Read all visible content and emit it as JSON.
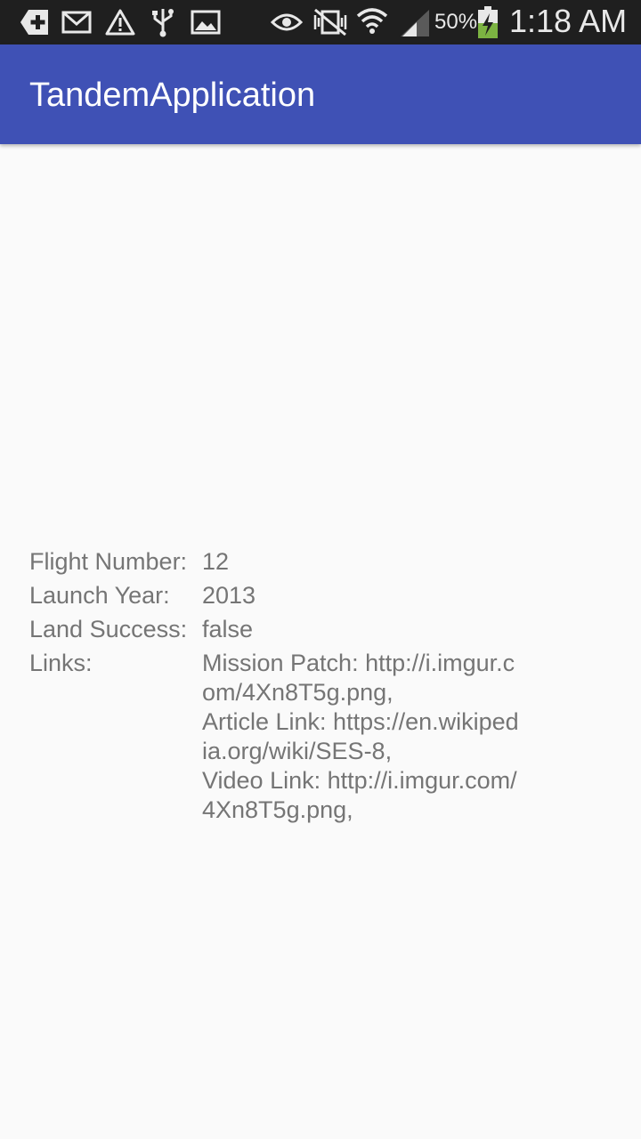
{
  "status_bar": {
    "battery_percent": "50%",
    "time": "1:18 AM",
    "icons": [
      "add-icon",
      "mail-icon",
      "warning-icon",
      "usb-icon",
      "image-icon",
      "eye-icon",
      "mute-vibrate-icon",
      "wifi-icon",
      "cell-signal-icon",
      "battery-charging-icon"
    ]
  },
  "app_bar": {
    "title": "TandemApplication",
    "color": "#3f51b5"
  },
  "details": {
    "flight_number": {
      "label": "Flight Number:",
      "value": "12"
    },
    "launch_year": {
      "label": "Launch Year:",
      "value": "2013"
    },
    "land_success": {
      "label": "Land Success:",
      "value": "false"
    },
    "links": {
      "label": "Links:",
      "mission_patch": "Mission Patch: http://​i.imgur.com/4Xn8T5g.png,",
      "article_link": "Article Link: https://​en.wikipedia.org/wiki/SES-8,",
      "video_link": "Video Link: http://​i.imgur.com/4Xn8T5g.png,"
    }
  }
}
